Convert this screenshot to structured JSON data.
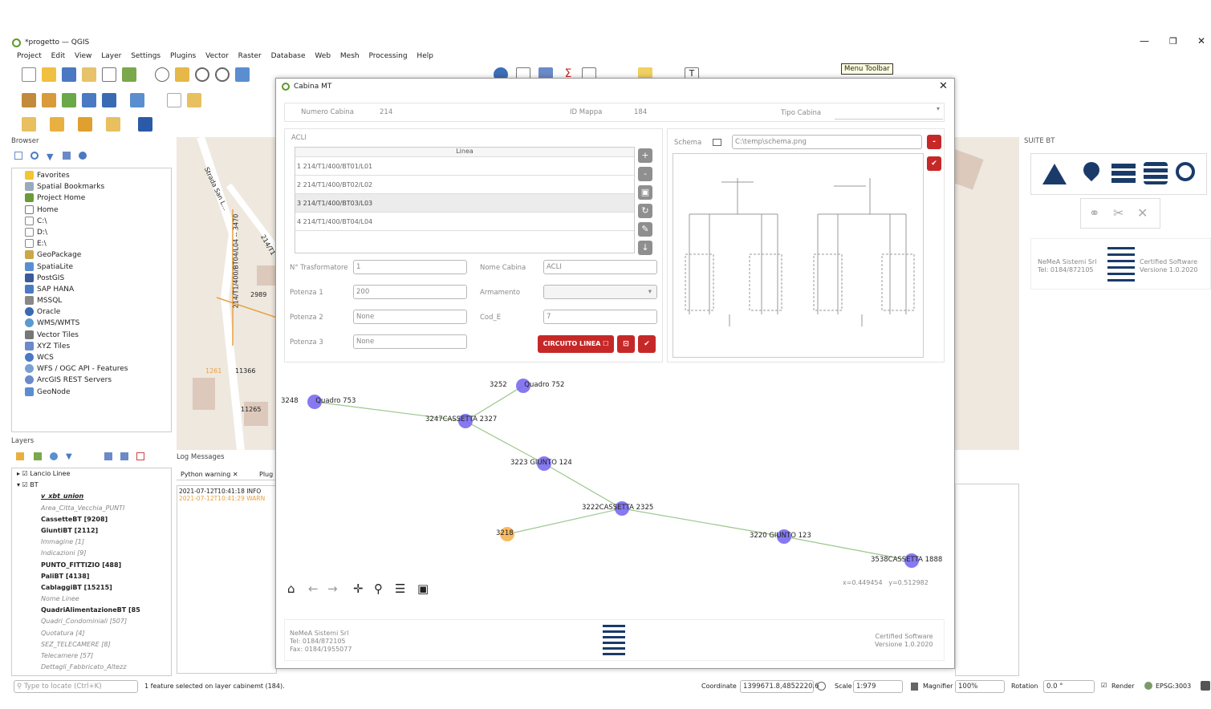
{
  "window": {
    "title": "*progetto — QGIS"
  },
  "menus": [
    "Project",
    "Edit",
    "View",
    "Layer",
    "Settings",
    "Plugins",
    "Vector",
    "Raster",
    "Database",
    "Web",
    "Mesh",
    "Processing",
    "Help"
  ],
  "tooltip": "Menu Toolbar",
  "browser": {
    "title": "Browser",
    "items": [
      "Favorites",
      "Spatial Bookmarks",
      "Project Home",
      "Home",
      "C:\\",
      "D:\\",
      "E:\\",
      "GeoPackage",
      "SpatiaLite",
      "PostGIS",
      "SAP HANA",
      "MSSQL",
      "Oracle",
      "WMS/WMTS",
      "Vector Tiles",
      "XYZ Tiles",
      "WCS",
      "WFS / OGC API - Features",
      "ArcGIS REST Servers",
      "GeoNode"
    ]
  },
  "layers": {
    "title": "Layers",
    "items": [
      "Lancio Linee",
      "BT",
      "v_xbt_union",
      "Area_Citta_Vecchia_PUNTI",
      "CassetteBT [9208]",
      "GiuntiBT [2112]",
      "Immagine [1]",
      "Indicazioni [9]",
      "PUNTO_FITTIZIO [488]",
      "PaliBT [4138]",
      "CablaggiBT [15215]",
      "Nome Linee",
      "QuadriAlimentazioneBT [85",
      "Quadri_Condominiali [507]",
      "Quotatura [4]",
      "SEZ_TELECAMERE [8]",
      "Telecamere [57]",
      "Dettagli_Fabbricato_Altezz"
    ]
  },
  "log": {
    "title": "Log Messages",
    "tabs": [
      "Python warning",
      "Plug"
    ],
    "rows": [
      {
        "time": "2021-07-12T10:41:18",
        "level": "INFO"
      },
      {
        "time": "2021-07-12T10:41:29",
        "level": "WARN"
      }
    ]
  },
  "map_labels": [
    "Strada San L...",
    "214/T1/400/BT04/L04 -- 3470",
    "2989",
    "11366",
    "11265",
    "214/T1",
    "1261"
  ],
  "dialog": {
    "title": "Cabina MT",
    "numero_label": "Numero Cabina",
    "numero_value": "214",
    "idmappa_label": "ID Mappa",
    "idmappa_value": "184",
    "tipo_label": "Tipo Cabina",
    "tipo_value": "",
    "acu_label": "ACLI",
    "col_header": "Linea",
    "lines": [
      "214/T1/400/BT01/L01",
      "214/T1/400/BT02/L02",
      "214/T1/400/BT03/L03",
      "214/T1/400/BT04/L04"
    ],
    "trasf_label": "N° Trasformatore",
    "trasf_value": "1",
    "nome_label": "Nome Cabina",
    "nome_value": "ACLI",
    "pot1_label": "Potenza 1",
    "pot1_value": "200",
    "arm_label": "Armamento",
    "arm_value": "",
    "pot2_label": "Potenza 2",
    "pot2_value": "None",
    "code_label": "Cod_E",
    "code_value": "7",
    "pot3_label": "Potenza 3",
    "pot3_value": "None",
    "circuito_label": "CIRCUITO LINEA",
    "schema_label": "Schema",
    "schema_path": "C:\\temp\\schema.png",
    "graph_nodes": [
      {
        "id": "3248",
        "label": "Quadro 753"
      },
      {
        "id": "3252",
        "label": "Quadro 752"
      },
      {
        "id": "3247",
        "label": "CASSETTA 2327"
      },
      {
        "id": "3223",
        "label": "GIUNTO 124"
      },
      {
        "id": "3222",
        "label": "CASSETTA 2325"
      },
      {
        "id": "3218",
        "label": ""
      },
      {
        "id": "3220",
        "label": "GIUNTO 123"
      },
      {
        "id": "3538",
        "label": "CASSETTA 1888"
      }
    ],
    "coords": "x=0.449454   y=0.512982",
    "footer_left": [
      "NeMeA Sistemi Srl",
      "Tel: 0184/872105",
      "Fax: 0184/1955077"
    ],
    "footer_right": [
      "Certified Software",
      "Versione 1.0.2020"
    ]
  },
  "suite": {
    "title": "SUITE BT",
    "company": [
      "NeMeA Sistemi Srl",
      "Tel: 0184/872105"
    ],
    "cert": [
      "Certified Software",
      "Versione 1.0.2020"
    ]
  },
  "statusbar": {
    "search_placeholder": "Type to locate (Ctrl+K)",
    "message": "1 feature selected on layer cabinemt (184).",
    "coord_label": "Coordinate",
    "coord_value": "1399671.8,4852220.6",
    "scale_label": "Scale",
    "scale_value": "1:979",
    "magnifier_label": "Magnifier",
    "magnifier_value": "100%",
    "rotation_label": "Rotation",
    "rotation_value": "0.0 °",
    "render_label": "Render",
    "crs": "EPSG:3003"
  },
  "colors": {
    "accent_red": "#c62828",
    "node_blue": "#7a6af0",
    "node_orange": "#f6b352"
  }
}
